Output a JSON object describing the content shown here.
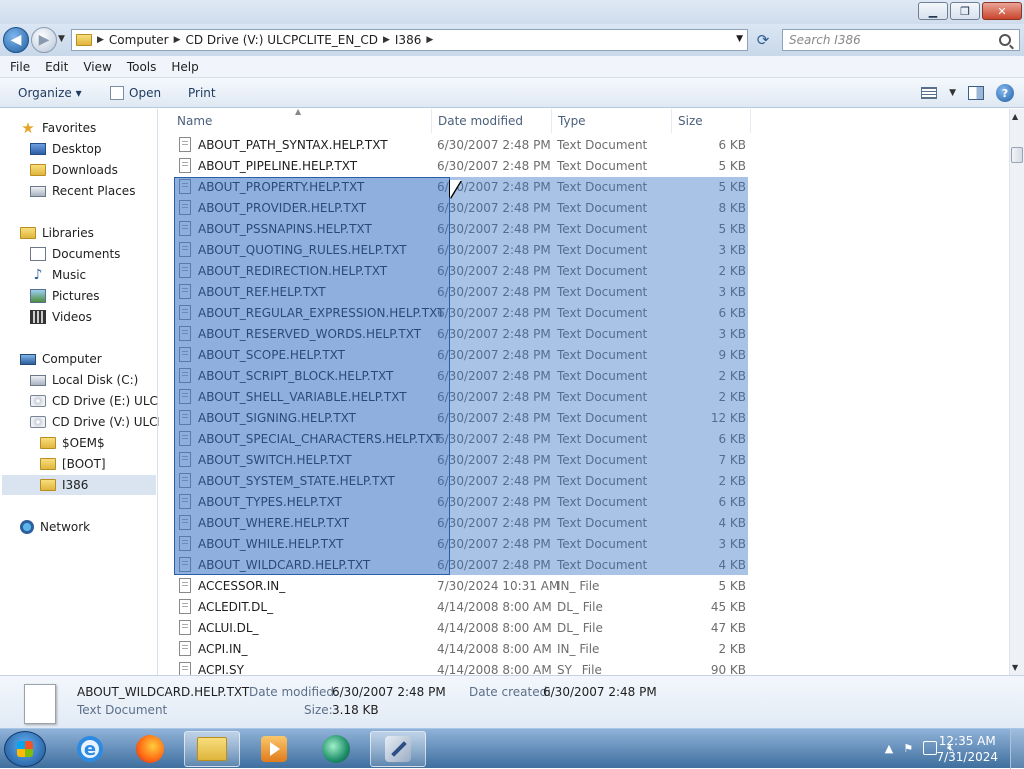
{
  "window": {
    "minimize": "▁",
    "maximize": "❐",
    "close": "✕"
  },
  "address": {
    "crumbs": [
      "Computer",
      "CD Drive (V:) ULCPCLITE_EN_CD",
      "I386"
    ],
    "search_placeholder": "Search I386"
  },
  "menu": [
    "File",
    "Edit",
    "View",
    "Tools",
    "Help"
  ],
  "toolbar": {
    "organize": "Organize ▾",
    "open": "Open",
    "print": "Print"
  },
  "nav": [
    {
      "label": "Favorites",
      "icon": "star-icon"
    },
    {
      "label": "Desktop",
      "icon": "desktop-icon"
    },
    {
      "label": "Downloads",
      "icon": "downloads-icon"
    },
    {
      "label": "Recent Places",
      "icon": "recent-places-icon"
    },
    {
      "label": "Libraries",
      "icon": "libraries-icon"
    },
    {
      "label": "Documents",
      "icon": "documents-icon"
    },
    {
      "label": "Music",
      "icon": "music-icon"
    },
    {
      "label": "Pictures",
      "icon": "pictures-icon"
    },
    {
      "label": "Videos",
      "icon": "videos-icon"
    },
    {
      "label": "Computer",
      "icon": "computer-icon"
    },
    {
      "label": "Local Disk (C:)",
      "icon": "disk-icon"
    },
    {
      "label": "CD Drive (E:) ULCPC",
      "icon": "cd-drive-icon"
    },
    {
      "label": "CD Drive (V:) ULCPC",
      "icon": "cd-drive-icon"
    },
    {
      "label": "$OEM$",
      "icon": "folder-icon"
    },
    {
      "label": "[BOOT]",
      "icon": "folder-icon"
    },
    {
      "label": "I386",
      "icon": "folder-icon"
    },
    {
      "label": "Network",
      "icon": "network-icon"
    }
  ],
  "columns": {
    "name": "Name",
    "date": "Date modified",
    "type": "Type",
    "size": "Size"
  },
  "files": [
    [
      "ABOUT_PATH_SYNTAX.HELP.TXT",
      "6/30/2007 2:48 PM",
      "Text Document",
      "6 KB",
      false
    ],
    [
      "ABOUT_PIPELINE.HELP.TXT",
      "6/30/2007 2:48 PM",
      "Text Document",
      "5 KB",
      false
    ],
    [
      "ABOUT_PROPERTY.HELP.TXT",
      "6/30/2007 2:48 PM",
      "Text Document",
      "5 KB",
      true
    ],
    [
      "ABOUT_PROVIDER.HELP.TXT",
      "6/30/2007 2:48 PM",
      "Text Document",
      "8 KB",
      true
    ],
    [
      "ABOUT_PSSNAPINS.HELP.TXT",
      "6/30/2007 2:48 PM",
      "Text Document",
      "5 KB",
      true
    ],
    [
      "ABOUT_QUOTING_RULES.HELP.TXT",
      "6/30/2007 2:48 PM",
      "Text Document",
      "3 KB",
      true
    ],
    [
      "ABOUT_REDIRECTION.HELP.TXT",
      "6/30/2007 2:48 PM",
      "Text Document",
      "2 KB",
      true
    ],
    [
      "ABOUT_REF.HELP.TXT",
      "6/30/2007 2:48 PM",
      "Text Document",
      "3 KB",
      true
    ],
    [
      "ABOUT_REGULAR_EXPRESSION.HELP.TXT",
      "6/30/2007 2:48 PM",
      "Text Document",
      "6 KB",
      true
    ],
    [
      "ABOUT_RESERVED_WORDS.HELP.TXT",
      "6/30/2007 2:48 PM",
      "Text Document",
      "3 KB",
      true
    ],
    [
      "ABOUT_SCOPE.HELP.TXT",
      "6/30/2007 2:48 PM",
      "Text Document",
      "9 KB",
      true
    ],
    [
      "ABOUT_SCRIPT_BLOCK.HELP.TXT",
      "6/30/2007 2:48 PM",
      "Text Document",
      "2 KB",
      true
    ],
    [
      "ABOUT_SHELL_VARIABLE.HELP.TXT",
      "6/30/2007 2:48 PM",
      "Text Document",
      "2 KB",
      true
    ],
    [
      "ABOUT_SIGNING.HELP.TXT",
      "6/30/2007 2:48 PM",
      "Text Document",
      "12 KB",
      true
    ],
    [
      "ABOUT_SPECIAL_CHARACTERS.HELP.TXT",
      "6/30/2007 2:48 PM",
      "Text Document",
      "6 KB",
      true
    ],
    [
      "ABOUT_SWITCH.HELP.TXT",
      "6/30/2007 2:48 PM",
      "Text Document",
      "7 KB",
      true
    ],
    [
      "ABOUT_SYSTEM_STATE.HELP.TXT",
      "6/30/2007 2:48 PM",
      "Text Document",
      "2 KB",
      true
    ],
    [
      "ABOUT_TYPES.HELP.TXT",
      "6/30/2007 2:48 PM",
      "Text Document",
      "6 KB",
      true
    ],
    [
      "ABOUT_WHERE.HELP.TXT",
      "6/30/2007 2:48 PM",
      "Text Document",
      "4 KB",
      true
    ],
    [
      "ABOUT_WHILE.HELP.TXT",
      "6/30/2007 2:48 PM",
      "Text Document",
      "3 KB",
      true
    ],
    [
      "ABOUT_WILDCARD.HELP.TXT",
      "6/30/2007 2:48 PM",
      "Text Document",
      "4 KB",
      true
    ],
    [
      "ACCESSOR.IN_",
      "7/30/2024 10:31 AM",
      "IN_ File",
      "5 KB",
      false
    ],
    [
      "ACLEDIT.DL_",
      "4/14/2008 8:00 AM",
      "DL_ File",
      "45 KB",
      false
    ],
    [
      "ACLUI.DL_",
      "4/14/2008 8:00 AM",
      "DL_ File",
      "47 KB",
      false
    ],
    [
      "ACPI.IN_",
      "4/14/2008 8:00 AM",
      "IN_ File",
      "2 KB",
      false
    ],
    [
      "ACPI.SY_",
      "4/14/2008 8:00 AM",
      "SY_ File",
      "90 KB",
      false
    ]
  ],
  "details": {
    "name": "ABOUT_WILDCARD.HELP.TXT",
    "type": "Text Document",
    "modified_label": "Date modified:",
    "modified": "6/30/2007 2:48 PM",
    "created_label": "Date created:",
    "created": "6/30/2007 2:48 PM",
    "size_label": "Size:",
    "size": "3.18 KB"
  },
  "clock": {
    "time": "12:35 AM",
    "date": "7/31/2024"
  },
  "colors": {
    "selection": "#3370c4",
    "titlebar": "#dae6f3"
  }
}
